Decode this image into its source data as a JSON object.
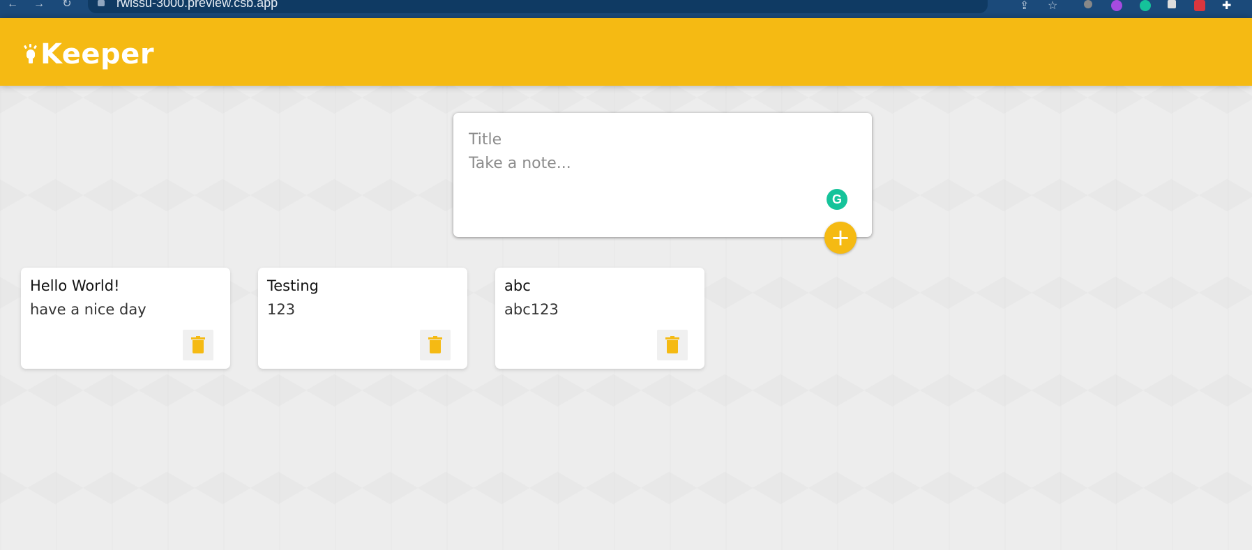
{
  "browser": {
    "url": "rwlssu-3000.preview.csb.app",
    "back_icon": "arrow-left-icon",
    "forward_icon": "arrow-right-icon",
    "reload_icon": "reload-icon"
  },
  "header": {
    "logo_text": "Keeper",
    "logo_icon": "lightbulb-icon"
  },
  "create": {
    "title_placeholder": "Title",
    "content_placeholder": "Take a note...",
    "add_label": "+"
  },
  "notes": [
    {
      "title": "Hello World!",
      "content": "have a nice day"
    },
    {
      "title": "Testing",
      "content": "123"
    },
    {
      "title": "abc",
      "content": "abc123"
    }
  ],
  "colors": {
    "accent": "#f5ba13",
    "browser_bar": "#1b4a7a",
    "background": "#ededed"
  }
}
